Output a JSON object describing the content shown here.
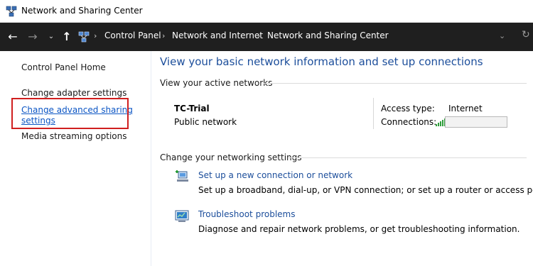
{
  "window": {
    "title": "Network and Sharing Center",
    "icon": "network-center-icon"
  },
  "nav": {
    "back_icon": "←",
    "forward_icon": "→",
    "recent_icon": "⌄",
    "up_icon": "↑"
  },
  "breadcrumb": {
    "separator": "›",
    "items": [
      "Control Panel",
      "Network and Internet",
      "Network and Sharing Center"
    ],
    "dropdown_icon": "⌄",
    "refresh_icon": "↻"
  },
  "sidebar": {
    "home": "Control Panel Home",
    "items": [
      "Change adapter settings",
      "Change advanced sharing",
      "settings",
      "Media streaming options"
    ],
    "highlight_color": "#d01f1f"
  },
  "main": {
    "title": "View your basic network information and set up connections",
    "active_networks_label": "View your active networks",
    "network": {
      "name": "TC-Trial",
      "type": "Public network",
      "access_type_label": "Access type:",
      "access_type_value": "Internet",
      "connections_label": "Connections:"
    },
    "change_settings_label": "Change your networking settings",
    "tasks": [
      {
        "link": "Set up a new connection or network",
        "desc": "Set up a broadband, dial-up, or VPN connection; or set up a router or access point.",
        "icon": "new-connection-icon"
      },
      {
        "link": "Troubleshoot problems",
        "desc": "Diagnose and repair network problems, or get troubleshooting information.",
        "icon": "troubleshoot-icon"
      }
    ]
  },
  "colors": {
    "link": "#1c4e9b",
    "addressbar": "#1f1f1f"
  }
}
